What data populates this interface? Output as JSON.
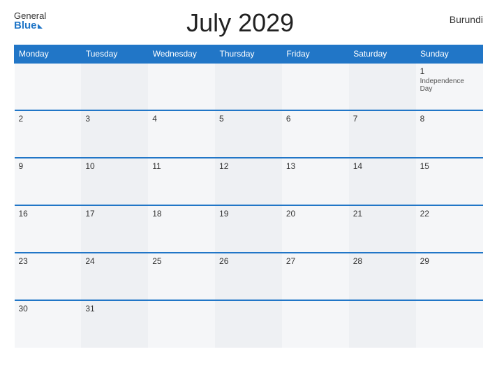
{
  "header": {
    "logo_general": "General",
    "logo_blue": "Blue",
    "title": "July 2029",
    "country": "Burundi"
  },
  "weekdays": [
    "Monday",
    "Tuesday",
    "Wednesday",
    "Thursday",
    "Friday",
    "Saturday",
    "Sunday"
  ],
  "weeks": [
    [
      {
        "day": "",
        "holiday": ""
      },
      {
        "day": "",
        "holiday": ""
      },
      {
        "day": "",
        "holiday": ""
      },
      {
        "day": "",
        "holiday": ""
      },
      {
        "day": "",
        "holiday": ""
      },
      {
        "day": "",
        "holiday": ""
      },
      {
        "day": "1",
        "holiday": "Independence Day"
      }
    ],
    [
      {
        "day": "2",
        "holiday": ""
      },
      {
        "day": "3",
        "holiday": ""
      },
      {
        "day": "4",
        "holiday": ""
      },
      {
        "day": "5",
        "holiday": ""
      },
      {
        "day": "6",
        "holiday": ""
      },
      {
        "day": "7",
        "holiday": ""
      },
      {
        "day": "8",
        "holiday": ""
      }
    ],
    [
      {
        "day": "9",
        "holiday": ""
      },
      {
        "day": "10",
        "holiday": ""
      },
      {
        "day": "11",
        "holiday": ""
      },
      {
        "day": "12",
        "holiday": ""
      },
      {
        "day": "13",
        "holiday": ""
      },
      {
        "day": "14",
        "holiday": ""
      },
      {
        "day": "15",
        "holiday": ""
      }
    ],
    [
      {
        "day": "16",
        "holiday": ""
      },
      {
        "day": "17",
        "holiday": ""
      },
      {
        "day": "18",
        "holiday": ""
      },
      {
        "day": "19",
        "holiday": ""
      },
      {
        "day": "20",
        "holiday": ""
      },
      {
        "day": "21",
        "holiday": ""
      },
      {
        "day": "22",
        "holiday": ""
      }
    ],
    [
      {
        "day": "23",
        "holiday": ""
      },
      {
        "day": "24",
        "holiday": ""
      },
      {
        "day": "25",
        "holiday": ""
      },
      {
        "day": "26",
        "holiday": ""
      },
      {
        "day": "27",
        "holiday": ""
      },
      {
        "day": "28",
        "holiday": ""
      },
      {
        "day": "29",
        "holiday": ""
      }
    ],
    [
      {
        "day": "30",
        "holiday": ""
      },
      {
        "day": "31",
        "holiday": ""
      },
      {
        "day": "",
        "holiday": ""
      },
      {
        "day": "",
        "holiday": ""
      },
      {
        "day": "",
        "holiday": ""
      },
      {
        "day": "",
        "holiday": ""
      },
      {
        "day": "",
        "holiday": ""
      }
    ]
  ]
}
